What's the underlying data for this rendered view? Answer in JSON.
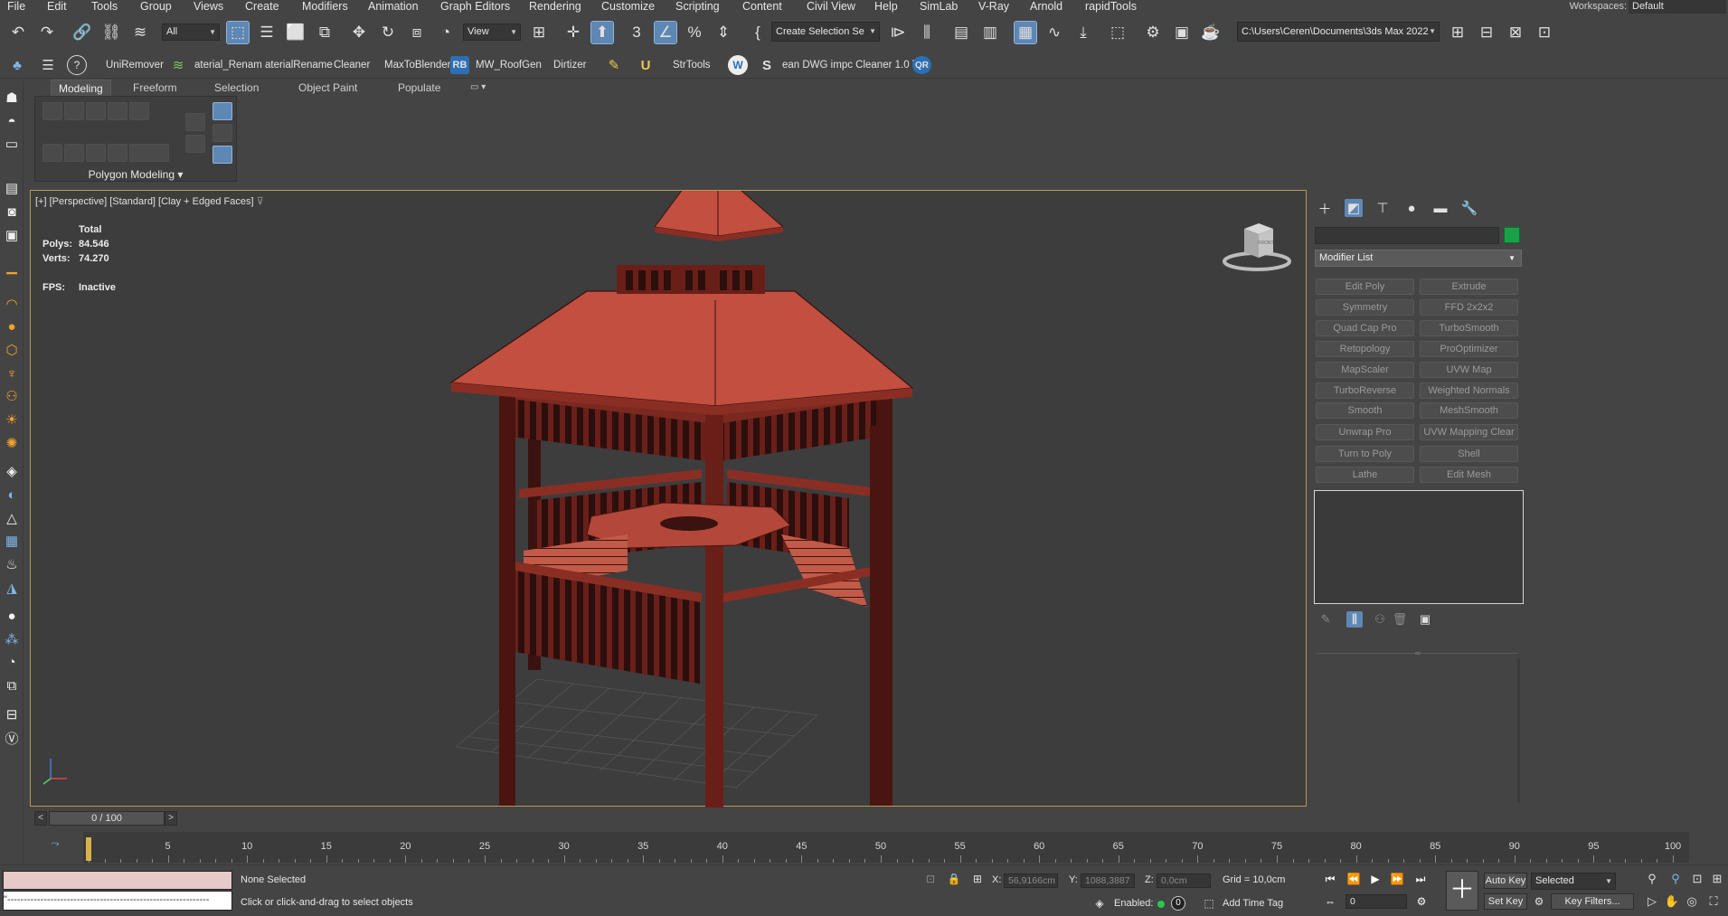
{
  "menu": {
    "items": [
      "File",
      "Edit",
      "Tools",
      "Group",
      "Views",
      "Create",
      "Modifiers",
      "Animation",
      "Graph Editors",
      "Rendering",
      "Customize",
      "Scripting",
      "Content",
      "Civil View",
      "Help",
      "SimLab",
      "V-Ray",
      "Arnold",
      "rapidTools"
    ],
    "workspaces_label": "Workspaces:",
    "workspace_value": "Default"
  },
  "toolbar1": {
    "filter_value": "All",
    "ref_coord_value": "View",
    "selection_set_value": "Create Selection Se",
    "project_path": "C:\\Users\\Ceren\\Documents\\3ds Max 2022"
  },
  "toolbar2": {
    "items": [
      "UniRemover",
      "aterial_Renam aterialRename",
      "Cleaner",
      "MaxToBlender",
      "MW_RoofGen",
      "Dirtizer",
      "StrTools",
      "ean DWG impc Cleaner 1.0 b"
    ],
    "rb_badge": "RB",
    "qr_badge": "QR"
  },
  "ribbon": {
    "tabs": [
      "Modeling",
      "Freeform",
      "Selection",
      "Object Paint",
      "Populate"
    ],
    "panel_label": "Polygon Modeling"
  },
  "viewport": {
    "label": "[+] [Perspective] [Standard] [Clay + Edged Faces]",
    "total_label": "Total",
    "polys_label": "Polys:",
    "polys_value": "84.546",
    "verts_label": "Verts:",
    "verts_value": "74.270",
    "fps_label": "FPS:",
    "fps_value": "Inactive",
    "viewcube_text": "FRONT"
  },
  "command_panel": {
    "modifier_list_label": "Modifier List",
    "object_color": "#1aa147",
    "modifiers": [
      [
        "Edit Poly",
        "Extrude"
      ],
      [
        "Symmetry",
        "FFD 2x2x2"
      ],
      [
        "Quad Cap Pro",
        "TurboSmooth"
      ],
      [
        "Retopology",
        "ProOptimizer"
      ],
      [
        "MapScaler",
        "UVW Map"
      ],
      [
        "TurboReverse",
        "Weighted Normals"
      ],
      [
        "Smooth",
        "MeshSmooth"
      ],
      [
        "Unwrap Pro",
        "UVW Mapping Clear"
      ],
      [
        "Turn to Poly",
        "Shell"
      ],
      [
        "Lathe",
        "Edit Mesh"
      ]
    ]
  },
  "timeline": {
    "slider_value": "0 / 100",
    "ticks": [
      "5",
      "10",
      "15",
      "20",
      "25",
      "30",
      "35",
      "40",
      "45",
      "50",
      "55",
      "60",
      "65",
      "70",
      "75",
      "80",
      "85",
      "90",
      "95",
      "100"
    ],
    "prev": "<",
    "next": ">"
  },
  "status": {
    "maxscript_text": "\"-------------------------------------------------------------",
    "selection_status": "None Selected",
    "prompt": "Click or click-and-drag to select objects",
    "x_label": "X:",
    "x_value": "56,9166cm",
    "y_label": "Y:",
    "y_value": "1088,3887",
    "z_label": "Z:",
    "z_value": "0,0cm",
    "grid": "Grid = 10,0cm",
    "enabled_label": "Enabled:",
    "enabled_count": "0",
    "add_time_tag": "Add Time Tag",
    "auto_key": "Auto Key",
    "selected_value": "Selected",
    "set_key": "Set Key",
    "key_filters": "Key Filters...",
    "frame_value": "0"
  }
}
